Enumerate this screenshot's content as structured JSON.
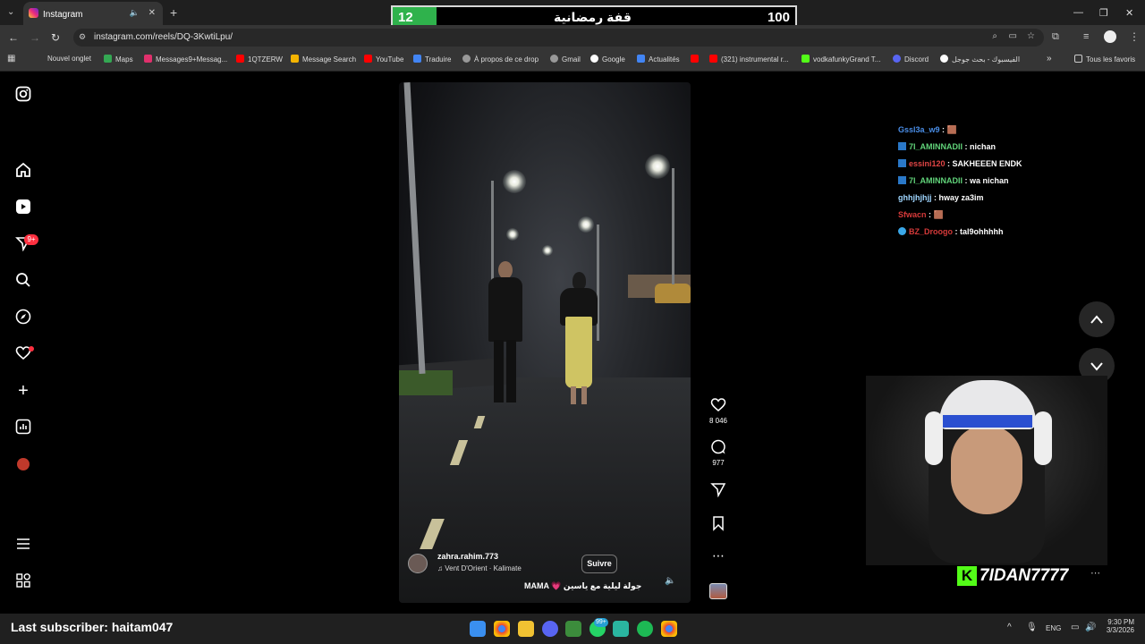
{
  "browser": {
    "tab_title": "Instagram",
    "url": "instagram.com/reels/DQ-3KwtiLpu/",
    "bookmarks": [
      "Nouvel onglet",
      "Maps",
      "Messages9+Messag...",
      "1QTZERW",
      "Message Search",
      "YouTube",
      "Traduire",
      "À propos de ce drop",
      "Gmail",
      "Google",
      "Actualités",
      "(321) instrumental r...",
      "vodkafunkyGrand T...",
      "Discord",
      "الفيسبوك - بحث جوجل",
      "Tous les favoris"
    ]
  },
  "scoreboard": {
    "left": "12",
    "title": "قفة رمضانية",
    "right": "100"
  },
  "sidebar": {
    "notifications_badge": "9+"
  },
  "reel": {
    "username": "zahra.rahim.773",
    "audio": "Vent D'Orient · Kalimate",
    "follow_label": "Suivre",
    "caption": "MAMA 💗 جولة ليلية مع ياسين",
    "likes": "8 046",
    "comments": "977"
  },
  "chat": [
    {
      "user": "Gssl3a_w9",
      "text": "🟫",
      "color": "#4a8ee8"
    },
    {
      "user": "7I_AMINNADII",
      "text": "nichan",
      "color": "#61d47a"
    },
    {
      "user": "essini120",
      "text": "SAKHEEEN ENDK",
      "color": "#e04545"
    },
    {
      "user": "7I_AMINNADII",
      "text": "wa nichan",
      "color": "#61d47a"
    },
    {
      "user": "ghhjhjhjj",
      "text": "hway za3im",
      "color": "#9fd6ff"
    },
    {
      "user": "Sfwacn",
      "text": "🟫",
      "color": "#d63a3a"
    },
    {
      "user": "BZ_Droogo",
      "text": "tal9ohhhhh",
      "color": "#d63a3a"
    }
  ],
  "stream": {
    "streamer": "7IDAN7777",
    "last_subscriber": "Last subscriber: haitam047"
  },
  "taskbar": {
    "lang": "ENG",
    "time": "9:30 PM",
    "date": "3/3/2026",
    "badge_whatsapp": "99+"
  }
}
